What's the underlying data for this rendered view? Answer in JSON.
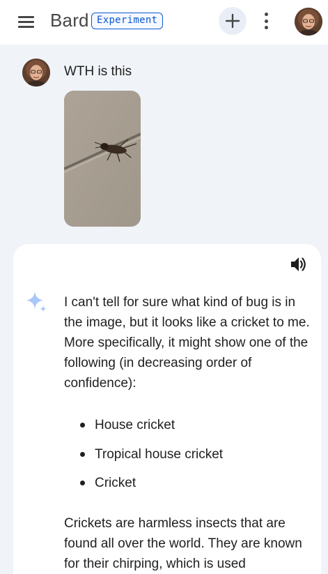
{
  "header": {
    "brand": "Bard",
    "badge": "Experiment",
    "menu_icon": "hamburger-menu-icon",
    "new_chat_icon": "plus-icon",
    "more_icon": "more-vert-icon"
  },
  "conversation": {
    "user_prompt": "WTH is this",
    "response": {
      "paragraph_1": "I can't tell for sure what kind of bug is in the image, but it looks like a cricket to me. More specifically, it might show one of the following (in decreasing order of confidence):",
      "bullets": [
        "House cricket",
        "Tropical house cricket",
        "Cricket"
      ],
      "paragraph_2": "Crickets are harmless insects that are found all over the world. They are known for their chirping, which is used"
    }
  },
  "colors": {
    "accent": "#0b57d0",
    "page_background": "#f0f4f9",
    "card_background": "#ffffff",
    "sparkle": "#a8c7fa"
  }
}
